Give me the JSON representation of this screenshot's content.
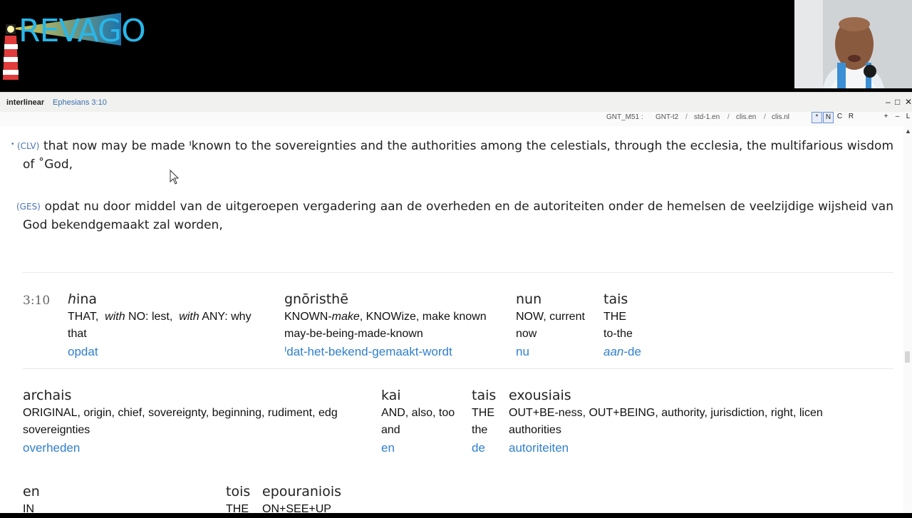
{
  "overlay": {
    "logo_text": "REVAGO"
  },
  "window": {
    "title": "interlinear",
    "reference": "Ephesians 3:10",
    "controls": [
      "–",
      "□",
      "✕"
    ]
  },
  "toolbar": {
    "modules": [
      "GNT_M51 :",
      "GNT-t2",
      "std-1.en",
      "clis.en",
      "clis.nl"
    ],
    "separator": "/",
    "buttons": [
      "*",
      "N",
      "C",
      "R"
    ],
    "zoom": [
      "+",
      "–",
      "L"
    ]
  },
  "verses": [
    {
      "label": "(CLV)",
      "text": "that now may be made ᑊknown to the sovereignties and the authorities among the celestials, through the ecclesia, the multifarious wisdom of ˚God,"
    },
    {
      "label": "(GES)",
      "text": "opdat nu door middel van de uitgeroepen vergadering aan de overheden en de autoriteiten onder de hemelsen de veelzijdige wijsheid van God bekendgemaakt zal worden,"
    }
  ],
  "interlinear": {
    "verse_number": "3:10",
    "rows": [
      [
        {
          "greek_pre": "h",
          "greek": "ina",
          "gloss": "THAT,  with NO: lest,  with ANY: why",
          "gloss2": "that",
          "dutch": "opdat"
        },
        {
          "greek": "gnōristhē",
          "gloss": "KNOWN-make, KNOWize, make known",
          "gloss2": "may-be-being-made-known",
          "dutch": "ᑊdat-het-bekend-gemaakt-wordt"
        },
        {
          "greek": "nun",
          "gloss": "NOW, current",
          "gloss2": "now",
          "dutch": "nu"
        },
        {
          "greek": "tais",
          "gloss": "THE",
          "gloss2": "to-the",
          "dutch_italic": "aan",
          "dutch": "-de"
        }
      ],
      [
        {
          "greek": "archais",
          "gloss": "ORIGINAL, origin, chief, sovereignty, beginning, rudiment, edg",
          "gloss2": "sovereignties",
          "dutch": "overheden"
        },
        {
          "greek": "kai",
          "gloss": "AND, also, too",
          "gloss2": "and",
          "dutch": "en"
        },
        {
          "greek": "tais",
          "gloss": "THE",
          "gloss2": "the",
          "dutch": "de"
        },
        {
          "greek": "exousiais",
          "gloss": "OUT+BE-ness, OUT+BEING, authority, jurisdiction, right, licen",
          "gloss2": "authorities",
          "dutch": "autoriteiten"
        }
      ],
      [
        {
          "greek": "en",
          "gloss": "IN",
          "gloss2": "",
          "dutch": ""
        },
        {
          "greek": "tois",
          "gloss": "THE",
          "gloss2": "",
          "dutch": ""
        },
        {
          "greek": "epouraniois",
          "gloss": "ON+SEE+UP",
          "gloss2": "",
          "dutch": ""
        }
      ]
    ]
  },
  "colors": {
    "accent": "#2f7fd0",
    "label": "#4a74b8",
    "background": "#ffffff",
    "overlay_bg": "#000000"
  }
}
